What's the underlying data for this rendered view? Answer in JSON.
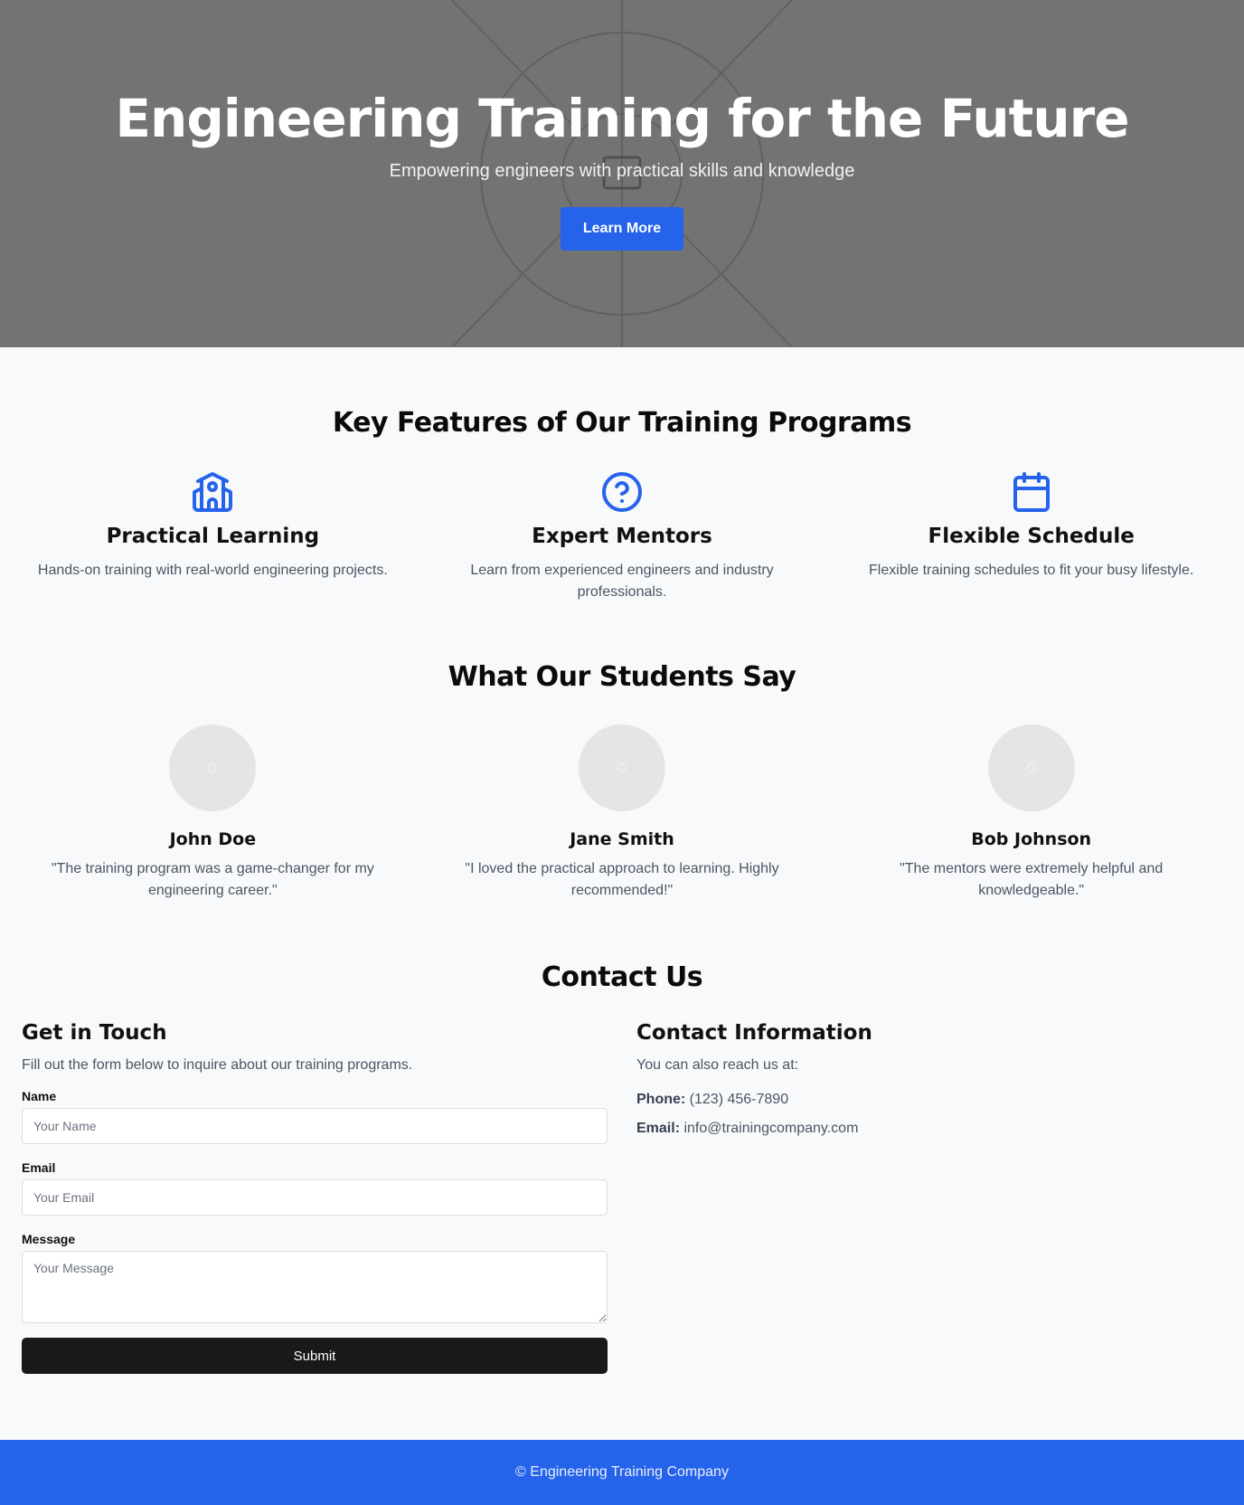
{
  "hero": {
    "title": "Engineering Training for the Future",
    "subtitle": "Empowering engineers with practical skills and knowledge",
    "cta_label": "Learn More"
  },
  "features": {
    "title": "Key Features of Our Training Programs",
    "items": [
      {
        "icon": "school-building-icon",
        "title": "Practical Learning",
        "desc": "Hands-on training with real-world engineering projects."
      },
      {
        "icon": "question-circle-icon",
        "title": "Expert Mentors",
        "desc": "Learn from experienced engineers and industry professionals."
      },
      {
        "icon": "calendar-icon",
        "title": "Flexible Schedule",
        "desc": "Flexible training schedules to fit your busy lifestyle."
      }
    ]
  },
  "testimonials": {
    "title": "What Our Students Say",
    "items": [
      {
        "name": "John Doe",
        "quote": "\"The training program was a game-changer for my engineering career.\""
      },
      {
        "name": "Jane Smith",
        "quote": "\"I loved the practical approach to learning. Highly recommended!\""
      },
      {
        "name": "Bob Johnson",
        "quote": "\"The mentors were extremely helpful and knowledgeable.\""
      }
    ]
  },
  "contact": {
    "title": "Contact Us",
    "form": {
      "title": "Get in Touch",
      "desc": "Fill out the form below to inquire about our training programs.",
      "name_label": "Name",
      "name_placeholder": "Your Name",
      "email_label": "Email",
      "email_placeholder": "Your Email",
      "message_label": "Message",
      "message_placeholder": "Your Message",
      "submit_label": "Submit"
    },
    "info": {
      "title": "Contact Information",
      "desc": "You can also reach us at:",
      "phone_label": "Phone:",
      "phone_value": "(123) 456-7890",
      "email_label": "Email:",
      "email_value": "info@trainingcompany.com"
    }
  },
  "footer": {
    "text": "© Engineering Training Company"
  },
  "colors": {
    "accent": "#2563eb",
    "hero_bg": "#737373",
    "submit_bg": "#18191b"
  }
}
